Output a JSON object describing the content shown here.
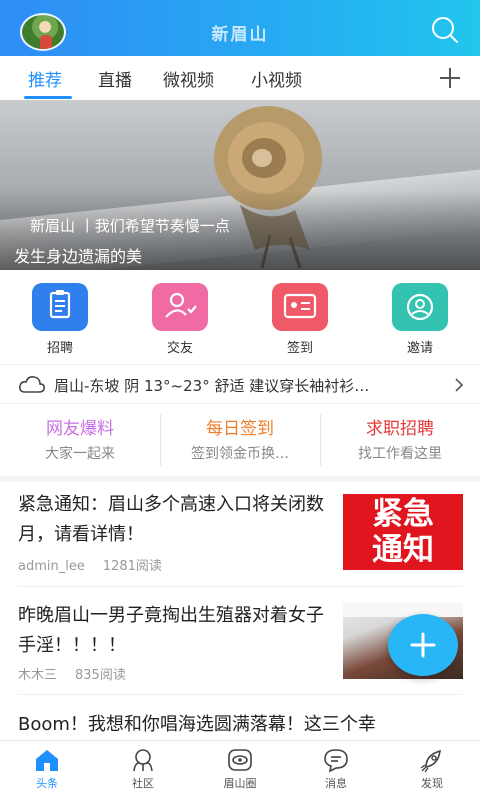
{
  "header": {
    "brand": "新眉山",
    "avatar": "avatar",
    "search_icon": "search-icon"
  },
  "tabs": [
    {
      "label": "推荐",
      "active": true
    },
    {
      "label": "直播"
    },
    {
      "label": "微视频"
    },
    {
      "label": "小视频"
    }
  ],
  "tab_add_icon": "plus-icon",
  "banner": {
    "source": "新眉山 丨我们希望节奏慢一点",
    "title": "发生身边遗漏的美"
  },
  "quick_actions": [
    {
      "label": "招聘",
      "icon": "clipboard-icon",
      "color": "#2f80ed"
    },
    {
      "label": "交友",
      "icon": "friend-icon",
      "color": "#f06aa4"
    },
    {
      "label": "签到",
      "icon": "idcard-icon",
      "color": "#f05a68"
    },
    {
      "label": "邀请",
      "icon": "invite-icon",
      "color": "#33c3b0"
    }
  ],
  "weather": {
    "text": "眉山-东坡 阴 13°~23° 舒适 建议穿长袖衬衫…",
    "icon": "cloud-icon"
  },
  "features": [
    {
      "title": "网友爆料",
      "subtitle": "大家一起来",
      "color": "#c86ee6"
    },
    {
      "title": "每日签到",
      "subtitle": "签到领金币换…",
      "color": "#f07c2a"
    },
    {
      "title": "求职招聘",
      "subtitle": "找工作看这里",
      "color": "#e2393a"
    }
  ],
  "news": [
    {
      "title": "紧急通知：眉山多个高速入口将关闭数月，请看详情！",
      "author": "admin_lee",
      "reads": "1281阅读",
      "thumb_text": "紧急\n通知"
    },
    {
      "title": "昨晚眉山一男子竟掏出生殖器对着女子手淫！！！！",
      "author": "木木三",
      "reads": "835阅读"
    },
    {
      "title": "Boom！我想和你唱海选圆满落幕！这三个幸"
    }
  ],
  "fab_icon": "plus-icon",
  "bottom_nav": [
    {
      "label": "头条",
      "active": true
    },
    {
      "label": "社区"
    },
    {
      "label": "眉山圈"
    },
    {
      "label": "消息"
    },
    {
      "label": "发现"
    }
  ],
  "accent": "#1e90ff"
}
